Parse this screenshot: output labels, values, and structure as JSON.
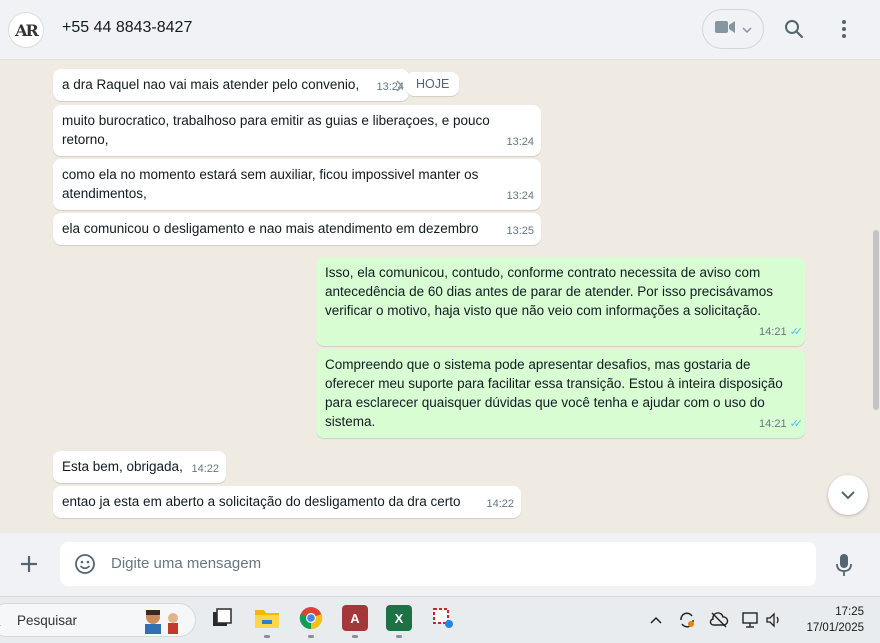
{
  "header": {
    "avatar_text": "AR",
    "contact_name": "+55 44 8843-8427"
  },
  "chat": {
    "date_chip": "HOJE",
    "messages": [
      {
        "direction": "in",
        "text": "a dra Raquel nao vai mais atender pelo convenio,",
        "time": "13:24"
      },
      {
        "direction": "in",
        "text": "muito burocratico, trabalhoso para emitir as guias e liberaçoes, e pouco retorno,",
        "time": "13:24"
      },
      {
        "direction": "in",
        "text": "como ela no momento estará sem auxiliar, ficou impossivel manter os atendimentos,",
        "time": "13:24"
      },
      {
        "direction": "in",
        "text": "ela comunicou o desligamento e nao mais atendimento em dezembro",
        "time": "13:25"
      },
      {
        "direction": "out",
        "text": "Isso, ela comunicou, contudo, conforme contrato necessita de aviso com antecedência de 60 dias antes de parar de atender. Por isso precisávamos verificar o motivo, haja visto que não veio com informações a solicitação.",
        "time": "14:21",
        "status": "read"
      },
      {
        "direction": "out",
        "text": "Compreendo que o sistema pode apresentar desafios, mas gostaria de oferecer meu suporte para facilitar essa transição. Estou à inteira disposição para esclarecer quaisquer dúvidas que você tenha e ajudar com o uso do sistema.",
        "time": "14:21",
        "status": "read"
      },
      {
        "direction": "in",
        "text": "Esta bem, obrigada,",
        "time": "14:22"
      },
      {
        "direction": "in",
        "text": "entao ja esta em aberto a solicitação do desligamento da dra certo",
        "time": "14:22"
      }
    ]
  },
  "composer": {
    "placeholder": "Digite uma mensagem"
  },
  "taskbar": {
    "search_label": "Pesquisar",
    "time": "17:25",
    "date": "17/01/2025",
    "apps": [
      "task-view",
      "file-explorer",
      "chrome",
      "access",
      "excel",
      "snipping-tool"
    ]
  },
  "colors": {
    "incoming_bubble": "#ffffff",
    "outgoing_bubble": "#d9fdd3",
    "chat_background": "#efeae2",
    "read_ticks": "#53bdeb"
  }
}
